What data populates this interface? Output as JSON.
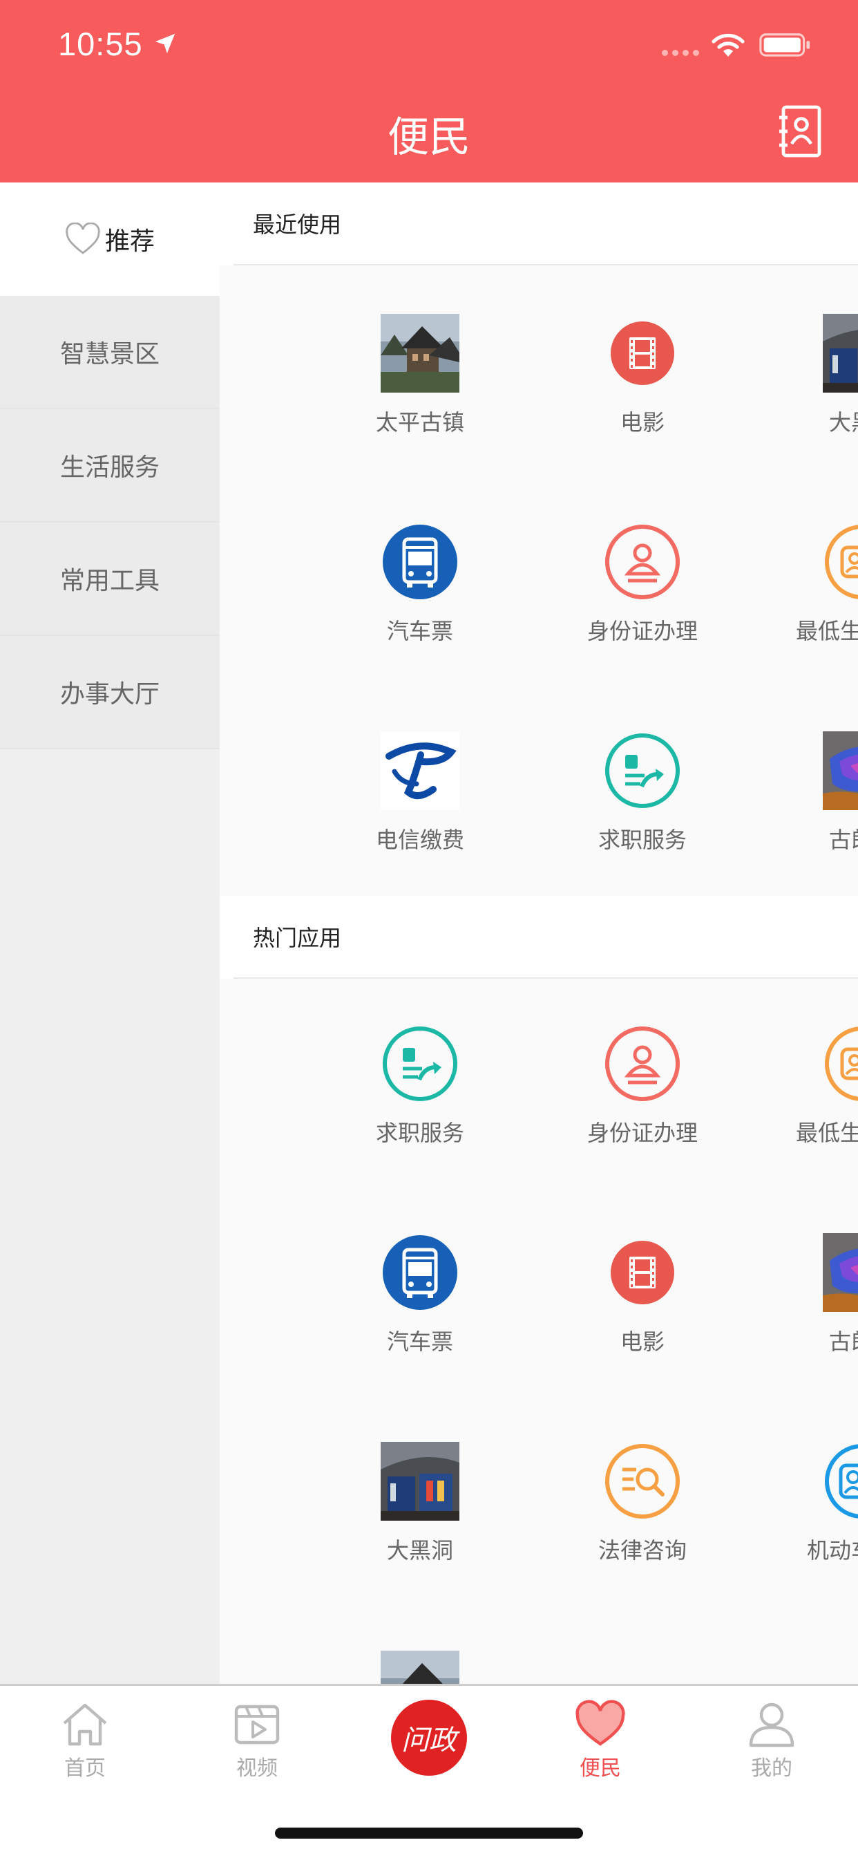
{
  "status": {
    "time": "10:55"
  },
  "header": {
    "title": "便民"
  },
  "sidebar": {
    "items": [
      {
        "label": "推荐",
        "active": true
      },
      {
        "label": "智慧景区"
      },
      {
        "label": "生活服务"
      },
      {
        "label": "常用工具"
      },
      {
        "label": "办事大厅"
      }
    ]
  },
  "recent": {
    "title": "最近使用",
    "items": [
      {
        "label": "太平古镇",
        "icon": "town-photo"
      },
      {
        "label": "电影",
        "icon": "film-icon"
      },
      {
        "label": "大黑洞",
        "icon": "cave-photo"
      },
      {
        "label": "汽车票",
        "icon": "bus-icon"
      },
      {
        "label": "身份证办理",
        "icon": "id-card-icon"
      },
      {
        "label": "最低生活保障",
        "icon": "welfare-icon"
      },
      {
        "label": "电信缴费",
        "icon": "telecom-icon"
      },
      {
        "label": "求职服务",
        "icon": "job-icon"
      },
      {
        "label": "古郎洞",
        "icon": "cave-photo"
      }
    ]
  },
  "hot": {
    "title": "热门应用",
    "items": [
      {
        "label": "求职服务",
        "icon": "job-icon"
      },
      {
        "label": "身份证办理",
        "icon": "id-card-icon"
      },
      {
        "label": "最低生活保障",
        "icon": "welfare-icon"
      },
      {
        "label": "汽车票",
        "icon": "bus-icon"
      },
      {
        "label": "电影",
        "icon": "film-icon"
      },
      {
        "label": "古郎洞",
        "icon": "cave-photo"
      },
      {
        "label": "大黑洞",
        "icon": "cave-photo"
      },
      {
        "label": "法律咨询",
        "icon": "legal-icon"
      },
      {
        "label": "机动车补证",
        "icon": "vehicle-cert-icon"
      }
    ]
  },
  "tabbar": {
    "items": [
      {
        "label": "首页",
        "icon": "home-icon"
      },
      {
        "label": "视频",
        "icon": "video-icon"
      },
      {
        "label": "问政",
        "icon": "wenzheng-logo"
      },
      {
        "label": "便民",
        "icon": "heart-icon",
        "active": true
      },
      {
        "label": "我的",
        "icon": "user-icon"
      }
    ]
  },
  "colors": {
    "brand": "#f75b5b",
    "active_tab": "#f0504f",
    "center_button": "#e12222",
    "job_teal": "#1cb8a6",
    "id_red": "#f36a62",
    "welfare_orange": "#f7a043",
    "bus_blue": "#1660b8",
    "vehicle_blue": "#1a9ae6"
  }
}
